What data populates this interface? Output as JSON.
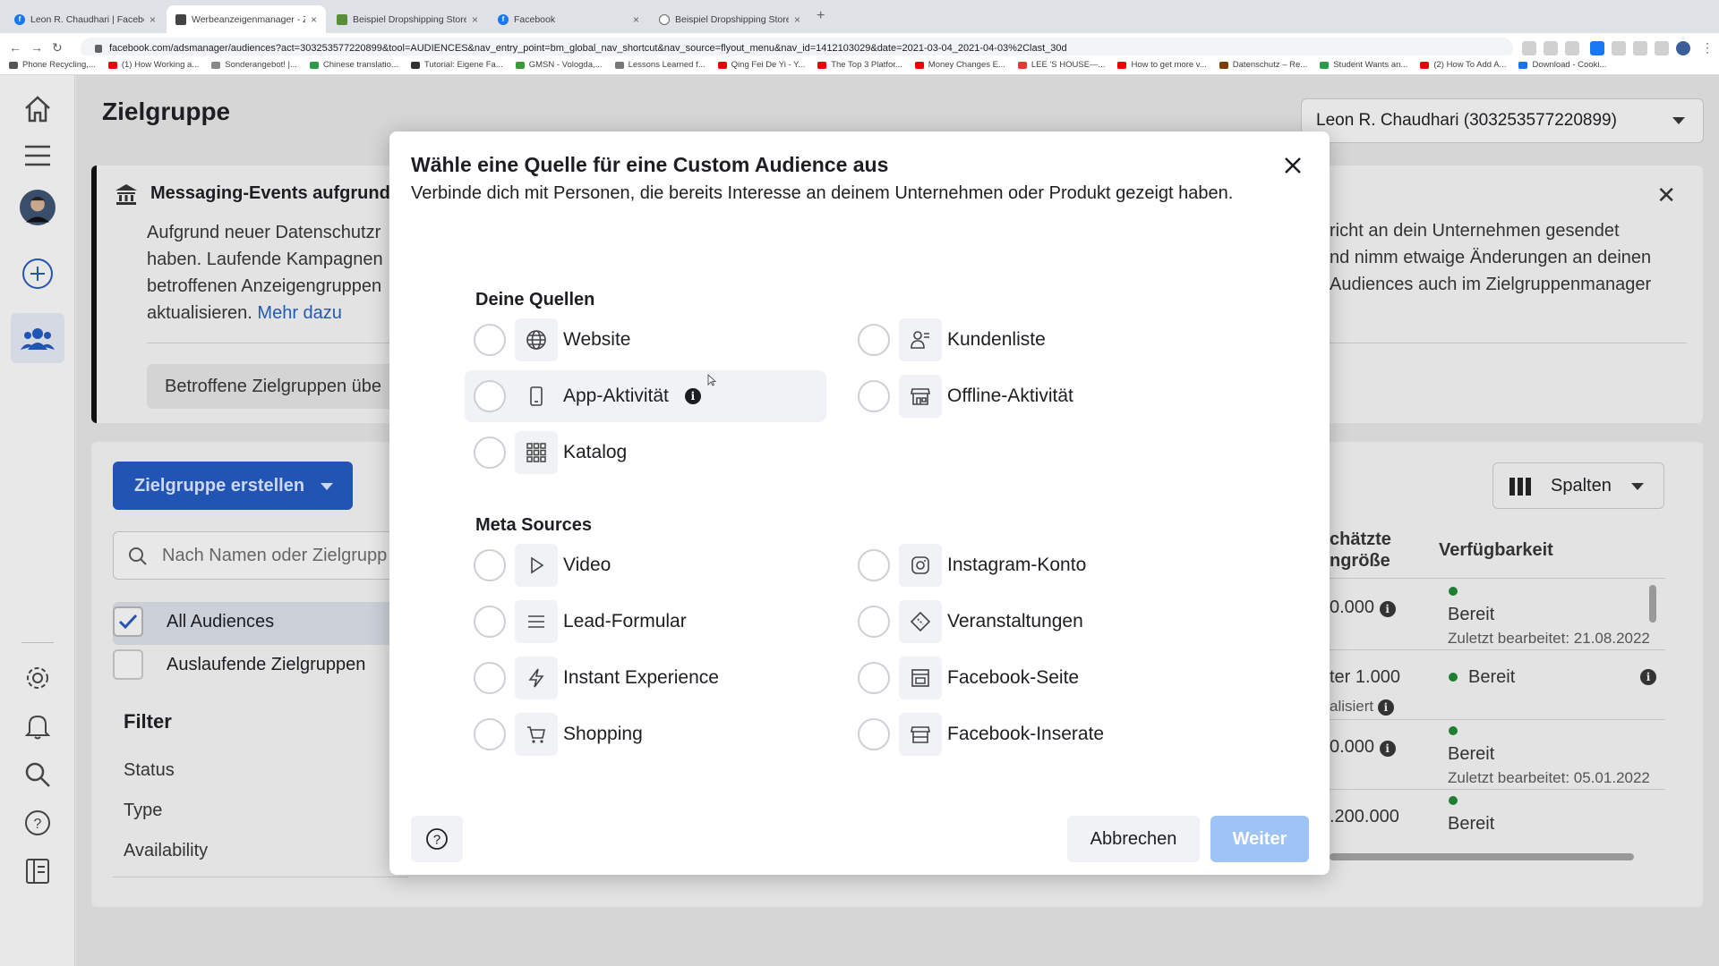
{
  "browser": {
    "tabs": [
      {
        "title": "Leon R. Chaudhari | Facebook",
        "active": false
      },
      {
        "title": "Werbeanzeigenmanager - Ziel",
        "active": true
      },
      {
        "title": "Beispiel Dropshipping Store - I",
        "active": false
      },
      {
        "title": "Facebook",
        "active": false
      },
      {
        "title": "Beispiel Dropshipping Store",
        "active": false
      }
    ],
    "url": "facebook.com/adsmanager/audiences?act=303253577220899&tool=AUDIENCES&nav_entry_point=bm_global_nav_shortcut&nav_source=flyout_menu&nav_id=1412103029&date=2021-03-04_2021-04-03%2Clast_30d",
    "bookmarks": [
      "Phone Recycling,...",
      "(1) How Working a...",
      "Sonderangebot! |...",
      "Chinese translatio...",
      "Tutorial: Eigene Fa...",
      "GMSN - Vologda,...",
      "Lessons Learned f...",
      "Qing Fei De Yi - Y...",
      "The Top 3 Platfor...",
      "Money Changes E...",
      "LEE 'S HOUSE—...",
      "How to get more v...",
      "Datenschutz – Re...",
      "Student Wants an...",
      "(2) How To Add A...",
      "Download - Cooki..."
    ]
  },
  "page": {
    "title": "Zielgruppe",
    "account": "Leon R. Chaudhari (303253577220899)",
    "notice": {
      "title": "Messaging-Events aufgrund n",
      "body_left": "Aufgrund neuer Datenschutzr",
      "body_line2": "haben. Laufende Kampagnen",
      "body_line3": "betroffenen Anzeigengruppen",
      "body_line4": "aktualisieren.",
      "link": "Mehr dazu",
      "right_line1": "richt an dein Unternehmen gesendet",
      "right_line2": "nd nimm etwaige Änderungen an deinen",
      "right_line3": "Audiences auch im Zielgruppenmanager",
      "button": "Betroffene Zielgruppen übe"
    },
    "create_button": "Zielgruppe erstellen",
    "search_placeholder": "Nach Namen oder Zielgrupp",
    "checkboxes": [
      {
        "label": "All Audiences",
        "checked": true
      },
      {
        "label": "Auslaufende Zielgruppen",
        "checked": false
      }
    ],
    "filter": {
      "heading": "Filter",
      "items": [
        "Status",
        "Type",
        "Availability"
      ]
    },
    "columns_button": "Spalten",
    "table": {
      "col_size_line1": "chätzte",
      "col_size_line2": "ngröße",
      "col_availability": "Verfügbarkeit",
      "rows": [
        {
          "size": "0.000",
          "status": "Bereit",
          "sub": "Zuletzt bearbeitet: 21.08.2022"
        },
        {
          "size": "ter 1.000",
          "status": "Bereit",
          "sub": "alisiert"
        },
        {
          "size": "0.000",
          "status": "Bereit",
          "sub": "Zuletzt bearbeitet: 05.01.2022"
        },
        {
          "size": ".200.000",
          "status": "Bereit",
          "sub": ""
        }
      ]
    }
  },
  "modal": {
    "title": "Wähle eine Quelle für eine Custom Audience aus",
    "subtitle": "Verbinde dich mit Personen, die bereits Interesse an deinem Unternehmen oder Produkt gezeigt haben.",
    "section_own": "Deine Quellen",
    "own_sources": [
      {
        "label": "Website",
        "icon": "globe-icon"
      },
      {
        "label": "Kundenliste",
        "icon": "customer-list-icon"
      },
      {
        "label": "App-Aktivität",
        "icon": "mobile-phone-icon"
      },
      {
        "label": "Offline-Aktivität",
        "icon": "store-icon"
      },
      {
        "label": "Katalog",
        "icon": "grid-icon"
      }
    ],
    "section_meta": "Meta Sources",
    "meta_sources": [
      {
        "label": "Video",
        "icon": "play-icon"
      },
      {
        "label": "Instagram-Konto",
        "icon": "instagram-icon"
      },
      {
        "label": "Lead-Formular",
        "icon": "lines-icon"
      },
      {
        "label": "Veranstaltungen",
        "icon": "ticket-icon"
      },
      {
        "label": "Instant Experience",
        "icon": "lightning-icon"
      },
      {
        "label": "Facebook-Seite",
        "icon": "page-icon"
      },
      {
        "label": "Shopping",
        "icon": "cart-icon"
      },
      {
        "label": "Facebook-Inserate",
        "icon": "shop-icon"
      }
    ],
    "cancel": "Abbrechen",
    "next": "Weiter"
  },
  "colors": {
    "primary": "#2254b4",
    "next_disabled": "#9ec3f5",
    "ready": "#1e7e34"
  }
}
